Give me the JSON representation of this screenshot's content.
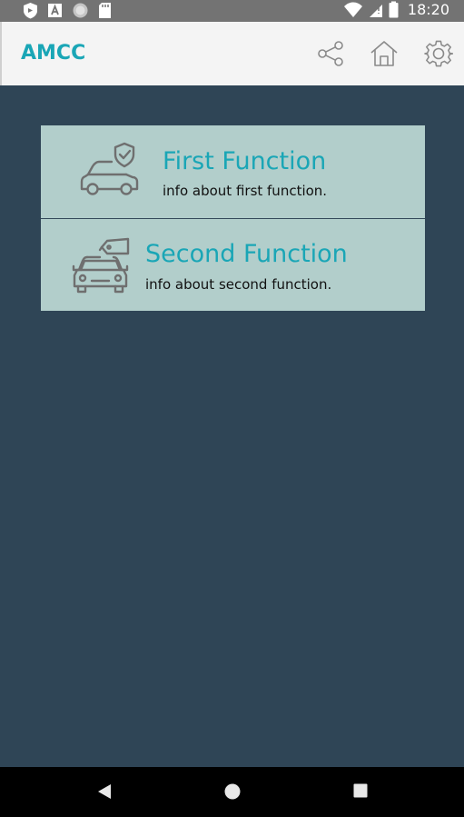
{
  "status_bar": {
    "time": "18:20",
    "left_icons": [
      "shield-notification-icon",
      "font-a-icon",
      "circle-dot-icon",
      "sd-card-icon"
    ],
    "right_icons": [
      "wifi-icon",
      "signal-icon",
      "battery-icon"
    ]
  },
  "app_bar": {
    "title": "AMCC",
    "actions": [
      "share-icon",
      "home-icon",
      "gear-icon"
    ]
  },
  "cards": [
    {
      "title": "First Function",
      "subtitle": "info about first function.",
      "icon": "car-shield-icon"
    },
    {
      "title": "Second Function",
      "subtitle": "info about second function.",
      "icon": "car-tag-icon"
    }
  ],
  "nav_bar": {
    "buttons": [
      "back-icon",
      "home-circle-icon",
      "recent-apps-icon"
    ]
  },
  "colors": {
    "accent": "#1aa6b6",
    "background": "#2f4556",
    "card": "#b2cecb",
    "status_bar": "#737373",
    "app_bar": "#f4f4f4"
  }
}
